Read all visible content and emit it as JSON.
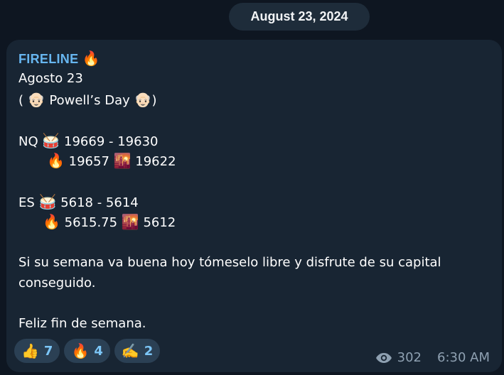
{
  "date_label": "August 23, 2024",
  "message": {
    "sender": "FIRELINE",
    "sender_emoji": "🔥",
    "lines": {
      "date": "Agosto 23",
      "powell_open": "(",
      "powell_emoji": "👴🏻",
      "powell_text": "Powell’s Day",
      "powell_close": ")",
      "nq_label": "NQ",
      "drum_emoji": "🥁",
      "nq_range": "19669 - 19630",
      "fire_emoji": "🔥",
      "nq_fire_value": "19657",
      "sunset_emoji": "🌇",
      "nq_sunset_value": "19622",
      "es_label": "ES",
      "es_range": "5618 - 5614",
      "es_fire_value": "5615.75",
      "es_sunset_value": "5612",
      "para1_line1": "Si su semana va buena hoy tómeselo libre y disfrute de su capital",
      "para1_line2": "conseguido.",
      "para2": "Feliz fin de semana."
    }
  },
  "reactions": [
    {
      "emoji": "👍",
      "count": "7"
    },
    {
      "emoji": "🔥",
      "count": "4"
    },
    {
      "emoji": "✍️",
      "count": "2"
    }
  ],
  "meta": {
    "views_icon": "eye-icon",
    "views": "302",
    "time": "6:30 AM"
  }
}
